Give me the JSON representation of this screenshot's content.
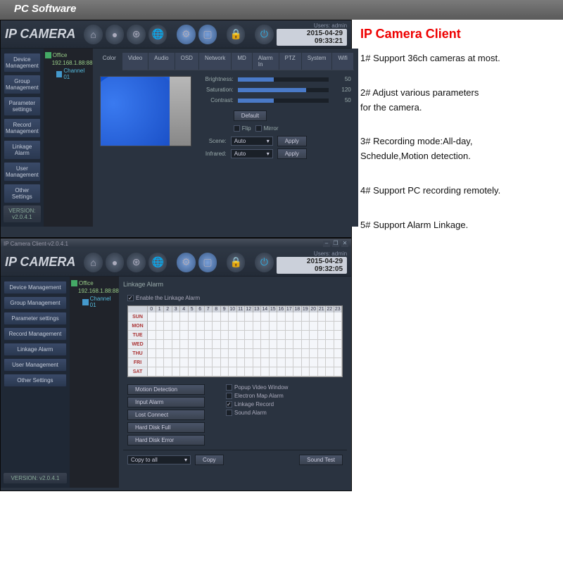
{
  "header": {
    "title": "PC Software"
  },
  "features": {
    "title": "IP Camera Client",
    "items": [
      "1# Support 36ch cameras at most.",
      "2# Adjust various parameters\n     for the camera.",
      "3# Recording mode:All-day,\n     Schedule,Motion detection.",
      "4# Support PC recording remotely.",
      "5# Support Alarm Linkage."
    ]
  },
  "app1": {
    "title": "",
    "logo": "IP CAMERA",
    "user": "Users: admin",
    "datetime": "2015-04-29 09:33:21",
    "version": "VERSION: v2.0.4.1",
    "sidebar": [
      "Device Management",
      "Group Management",
      "Parameter settings",
      "Record Management",
      "Linkage Alarm",
      "User Management",
      "Other Settings"
    ],
    "tree": {
      "root": "Office",
      "ip": "192.168.1.88:88",
      "channel": "Channel 01"
    },
    "tabs": [
      "Color",
      "Video",
      "Audio",
      "OSD",
      "Network",
      "MD",
      "Alarm In",
      "PTZ",
      "System",
      "Wifi"
    ],
    "sliders": [
      {
        "label": "Brightness:",
        "value": 50,
        "pct": 40
      },
      {
        "label": "Saturation:",
        "value": 120,
        "pct": 75
      },
      {
        "label": "Contrast:",
        "value": 50,
        "pct": 40
      }
    ],
    "default_btn": "Default",
    "flip": "Flip",
    "mirror": "Mirror",
    "scene_label": "Scene:",
    "scene_val": "Auto",
    "infrared_label": "Infrared:",
    "infrared_val": "Auto",
    "apply": "Apply"
  },
  "app2": {
    "title": "IP Camera Client-v2.0.4.1",
    "logo": "IP CAMERA",
    "user": "Users: admin",
    "datetime": "2015-04-29 09:32:05",
    "version": "VERSION: v2.0.4.1",
    "sidebar": [
      "Device Management",
      "Group Management",
      "Parameter settings",
      "Record Management",
      "Linkage Alarm",
      "User Management",
      "Other Settings"
    ],
    "tree": {
      "root": "Office",
      "ip": "192.168.1.88:88",
      "channel": "Channel 01"
    },
    "linkage_title": "Linkage Alarm",
    "enable": "Enable the Linkage Alarm",
    "hours": [
      "0",
      "1",
      "2",
      "3",
      "4",
      "5",
      "6",
      "7",
      "8",
      "9",
      "10",
      "11",
      "12",
      "13",
      "14",
      "15",
      "16",
      "17",
      "18",
      "19",
      "20",
      "21",
      "22",
      "23"
    ],
    "days": [
      "SUN",
      "MON",
      "TUE",
      "WED",
      "THU",
      "FRI",
      "SAT"
    ],
    "alarm_left": [
      "Motion Detection",
      "Input Alarm",
      "Lost Connect",
      "Hard Disk Full",
      "Hard Disk Error"
    ],
    "alarm_right": [
      {
        "label": "Popup Video Window",
        "checked": false
      },
      {
        "label": "Electron Map Alarm",
        "checked": false
      },
      {
        "label": "Linkage Record",
        "checked": true
      },
      {
        "label": "Sound Alarm",
        "checked": false
      }
    ],
    "copy_to": "Copy to all",
    "copy": "Copy",
    "sound_test": "Sound Test"
  }
}
